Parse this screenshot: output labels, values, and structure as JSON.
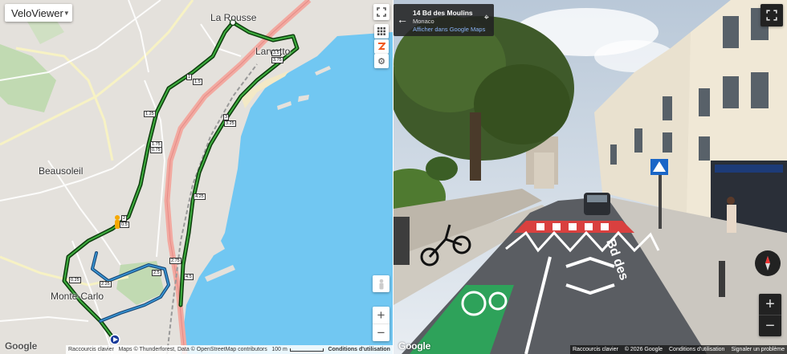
{
  "map": {
    "app_select": {
      "label": "VeloViewer"
    },
    "places": [
      "La Rousse",
      "Larvotto",
      "Beausoleil",
      "Monte-Carlo"
    ],
    "km_markers": [
      "0.25",
      "0.5",
      "0.75",
      "1",
      "1.25",
      "1.5",
      "1.75",
      "2",
      "2.25",
      "2.5",
      "2.75",
      "3",
      "3.25",
      "3.5",
      "3.75",
      "4",
      "4.25",
      "4.5"
    ],
    "google_logo": "Google",
    "attribution": {
      "keyboard": "Raccourcis clavier",
      "data": "Maps © Thunderforest, Data © OpenStreetMap contributors",
      "scale": "100 m",
      "terms": "Conditions d'utilisation"
    },
    "zoom_in": "+",
    "zoom_out": "−",
    "colors": {
      "route": "#1a6b1a",
      "route_dark": "#0d3d0d",
      "sea": "#6ec6f2",
      "land": "#e6e3df",
      "road": "#f2a9a0"
    }
  },
  "streetview": {
    "address": "14 Bd des Moulins",
    "city": "Monaco",
    "link": "Afficher dans Google Maps",
    "road_text": "Bd des",
    "google_logo": "Google",
    "attribution": {
      "keyboard": "Raccourcis clavier",
      "copyright": "© 2026 Google",
      "terms": "Conditions d'utilisation",
      "report": "Signaler un problème"
    },
    "zoom_in": "+",
    "zoom_out": "−"
  }
}
